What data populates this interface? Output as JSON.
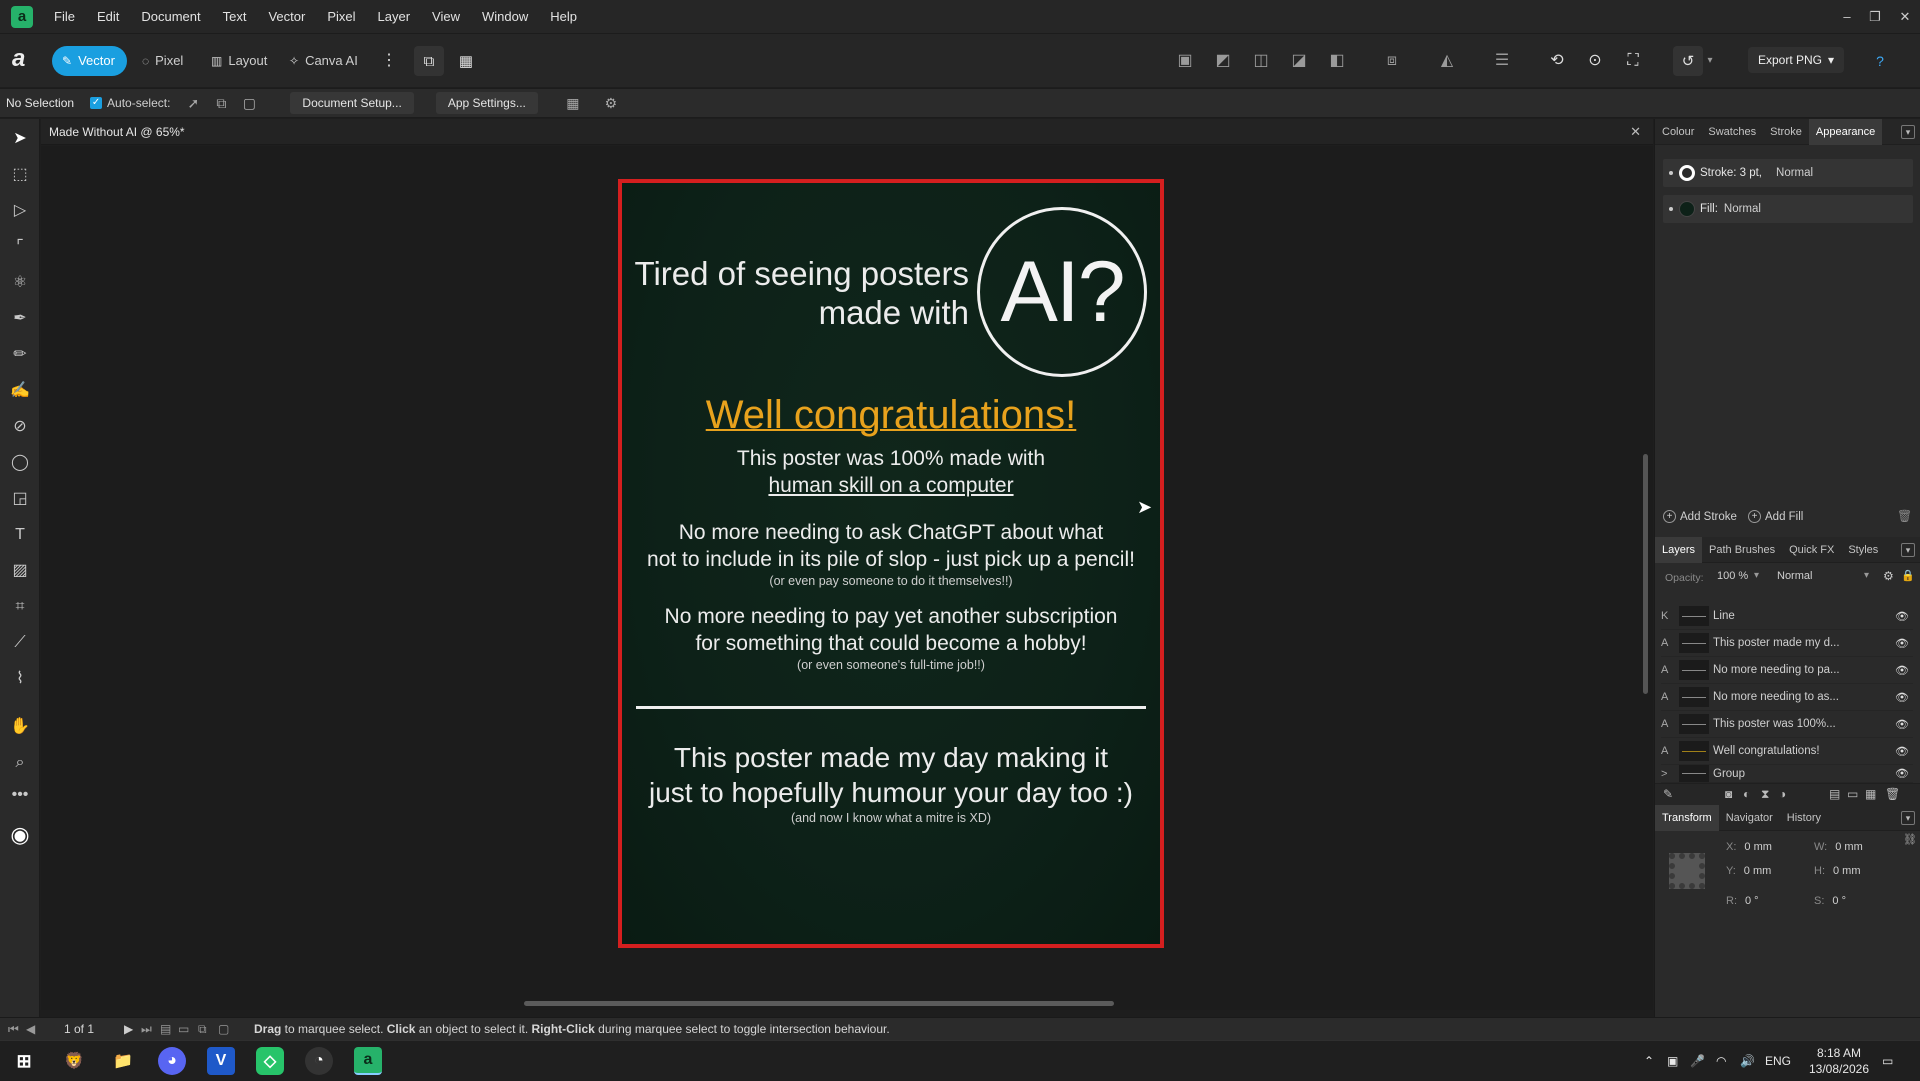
{
  "menu": [
    "File",
    "Edit",
    "Document",
    "Text",
    "Vector",
    "Pixel",
    "Layer",
    "View",
    "Window",
    "Help"
  ],
  "personas": [
    {
      "label": "Vector",
      "active": true
    },
    {
      "label": "Pixel",
      "active": false
    },
    {
      "label": "Layout",
      "active": false
    },
    {
      "label": "Canva AI",
      "active": false
    }
  ],
  "toolbar": {
    "export_label": "Export PNG"
  },
  "context": {
    "selection": "No Selection",
    "autoselect": "Auto-select:",
    "doc_setup": "Document Setup...",
    "app_settings": "App Settings..."
  },
  "document": {
    "tab_title": "Made Without AI @ 65%*"
  },
  "poster": {
    "headline_line1": "Tired of seeing posters",
    "headline_line2": "made with",
    "ai_badge": "AI?",
    "congrats": "Well congratulations!",
    "p1_line1": "This poster was 100% made with",
    "p1_line2": "human skill on a computer",
    "p2_line1": "No more needing to ask ChatGPT about what",
    "p2_line2": "not to include in its pile of slop - just pick up a pencil!",
    "p2_small": "(or even pay someone to do it themselves!!)",
    "p3_line1": "No more needing to pay yet another subscription",
    "p3_line2": "for something that could become a hobby!",
    "p3_small": "(or even someone's full-time job!!)",
    "p4_line1": "This poster made my day making it",
    "p4_line2": "just to hopefully humour your day too :)",
    "p4_small": "(and now I know what a mitre is XD)",
    "colors": {
      "border": "#d41f1f",
      "background": "#0d2118",
      "congrats": "#e8a21d"
    }
  },
  "panel_top": {
    "tabs": [
      "Colour",
      "Swatches",
      "Stroke",
      "Appearance"
    ],
    "active_tab": "Appearance",
    "stroke_label": "Stroke: 3 pt,",
    "stroke_mode": "Normal",
    "fill_label": "Fill:",
    "fill_mode": "Normal",
    "add_stroke": "Add Stroke",
    "add_fill": "Add Fill"
  },
  "layers_panel": {
    "tabs": [
      "Layers",
      "Path Brushes",
      "Quick FX",
      "Styles"
    ],
    "opacity_label": "Opacity:",
    "opacity_value": "100 %",
    "blend_mode": "Normal",
    "layers": [
      {
        "type": "K",
        "name": "Line"
      },
      {
        "type": "A",
        "name": "This poster made my d..."
      },
      {
        "type": "A",
        "name": "No more needing to pa..."
      },
      {
        "type": "A",
        "name": "No more needing to as..."
      },
      {
        "type": "A",
        "name": "This poster was 100%..."
      },
      {
        "type": "A",
        "name": "Well congratulations!"
      },
      {
        "type": ">",
        "name": "Group"
      }
    ]
  },
  "transform_panel": {
    "tabs": [
      "Transform",
      "Navigator",
      "History"
    ],
    "x_label": "X:",
    "x_value": "0 mm",
    "y_label": "Y:",
    "y_value": "0 mm",
    "w_label": "W:",
    "w_value": "0 mm",
    "h_label": "H:",
    "h_value": "0 mm",
    "r_label": "R:",
    "r_value": "0 °",
    "s_label": "S:",
    "s_value": "0 °"
  },
  "status": {
    "page": "1 of 1",
    "hint_b1": "Drag",
    "hint_t1": " to marquee select. ",
    "hint_b2": "Click",
    "hint_t2": " an object to select it. ",
    "hint_b3": "Right-Click",
    "hint_t3": " during marquee select to toggle intersection behaviour."
  },
  "taskbar": {
    "lang": "ENG",
    "time": "8:18 AM",
    "date": "13/08/2026"
  }
}
